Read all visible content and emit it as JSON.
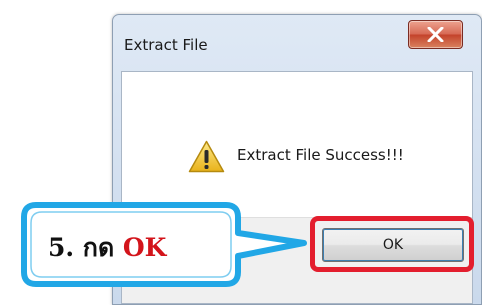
{
  "dialog": {
    "title": "Extract File",
    "message": "Extract File Success!!!",
    "ok_label": "OK",
    "icon": "warning-icon"
  },
  "callout": {
    "step_text": "5. กด ",
    "highlight_text": "OK"
  },
  "colors": {
    "callout_border": "#21a7e6",
    "highlight_border": "#e31e2e",
    "highlight_text": "#d3141b",
    "close_button": "#c4432b"
  }
}
